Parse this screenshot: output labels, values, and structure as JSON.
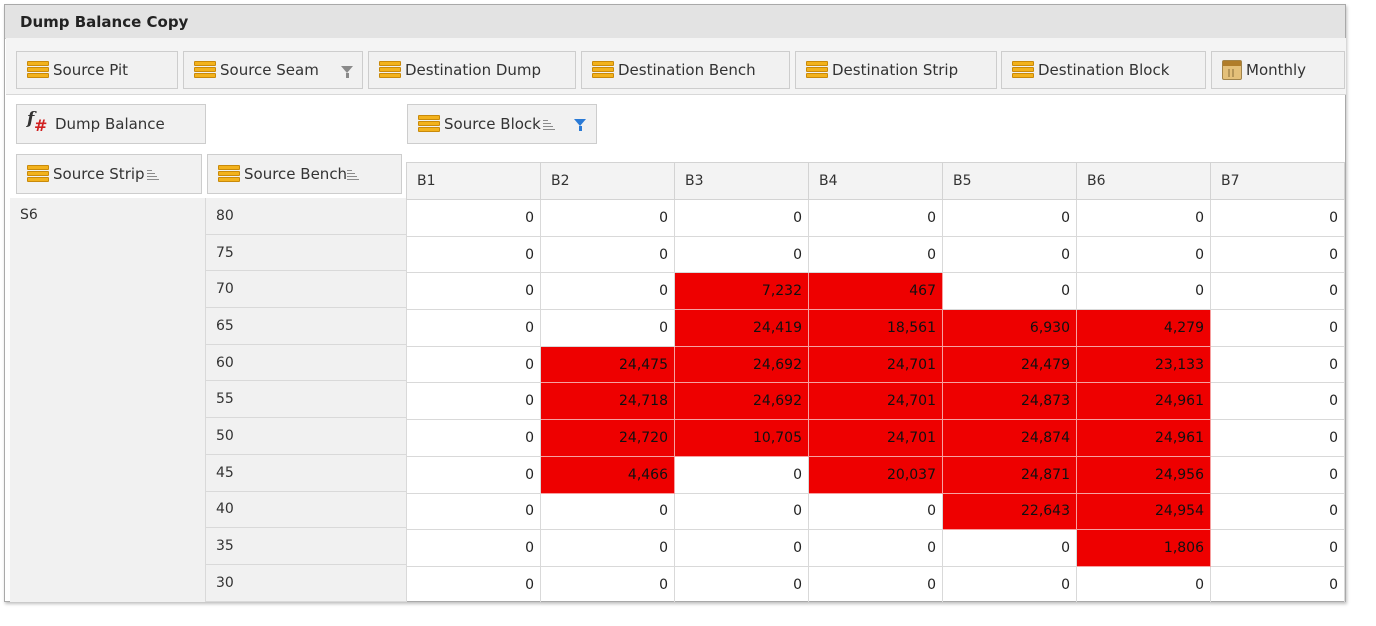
{
  "title": "Dump Balance Copy",
  "filter_fields": [
    {
      "label": "Source Pit",
      "icon": "field-icon"
    },
    {
      "label": "Source Seam",
      "icon": "field-icon",
      "filter_icon": "filter-icon"
    },
    {
      "label": "Destination Dump",
      "icon": "field-icon"
    },
    {
      "label": "Destination Bench",
      "icon": "field-icon"
    },
    {
      "label": "Destination Strip",
      "icon": "field-icon"
    },
    {
      "label": "Destination Block",
      "icon": "field-icon"
    },
    {
      "label": "Monthly",
      "icon": "calendar-icon"
    }
  ],
  "data_field": {
    "label": "Dump Balance",
    "icon": "calculated-field-icon"
  },
  "column_field": {
    "label": "Source Block",
    "icon": "field-icon",
    "sort_icon": "sort-icon",
    "filter_icon": "filter-active-icon"
  },
  "row_fields": [
    {
      "label": "Source Strip",
      "icon": "field-icon",
      "sort_icon": "sort-icon"
    },
    {
      "label": "Source Bench",
      "icon": "field-icon",
      "sort_icon": "sort-icon"
    }
  ],
  "columns": [
    "B1",
    "B2",
    "B3",
    "B4",
    "B5",
    "B6",
    "B7"
  ],
  "outer_row": "S6",
  "highlight_color": "#ee0000",
  "rows": [
    {
      "bench": "80",
      "cells": [
        {
          "v": "0",
          "h": false
        },
        {
          "v": "0",
          "h": false
        },
        {
          "v": "0",
          "h": false
        },
        {
          "v": "0",
          "h": false
        },
        {
          "v": "0",
          "h": false
        },
        {
          "v": "0",
          "h": false
        },
        {
          "v": "0",
          "h": false
        }
      ]
    },
    {
      "bench": "75",
      "cells": [
        {
          "v": "0",
          "h": false
        },
        {
          "v": "0",
          "h": false
        },
        {
          "v": "0",
          "h": false
        },
        {
          "v": "0",
          "h": false
        },
        {
          "v": "0",
          "h": false
        },
        {
          "v": "0",
          "h": false
        },
        {
          "v": "0",
          "h": false
        }
      ]
    },
    {
      "bench": "70",
      "cells": [
        {
          "v": "0",
          "h": false
        },
        {
          "v": "0",
          "h": false
        },
        {
          "v": "7,232",
          "h": true
        },
        {
          "v": "467",
          "h": true
        },
        {
          "v": "0",
          "h": false
        },
        {
          "v": "0",
          "h": false
        },
        {
          "v": "0",
          "h": false
        }
      ]
    },
    {
      "bench": "65",
      "cells": [
        {
          "v": "0",
          "h": false
        },
        {
          "v": "0",
          "h": false
        },
        {
          "v": "24,419",
          "h": true
        },
        {
          "v": "18,561",
          "h": true
        },
        {
          "v": "6,930",
          "h": true
        },
        {
          "v": "4,279",
          "h": true
        },
        {
          "v": "0",
          "h": false
        }
      ]
    },
    {
      "bench": "60",
      "cells": [
        {
          "v": "0",
          "h": false
        },
        {
          "v": "24,475",
          "h": true
        },
        {
          "v": "24,692",
          "h": true
        },
        {
          "v": "24,701",
          "h": true
        },
        {
          "v": "24,479",
          "h": true
        },
        {
          "v": "23,133",
          "h": true
        },
        {
          "v": "0",
          "h": false
        }
      ]
    },
    {
      "bench": "55",
      "cells": [
        {
          "v": "0",
          "h": false
        },
        {
          "v": "24,718",
          "h": true
        },
        {
          "v": "24,692",
          "h": true
        },
        {
          "v": "24,701",
          "h": true
        },
        {
          "v": "24,873",
          "h": true
        },
        {
          "v": "24,961",
          "h": true
        },
        {
          "v": "0",
          "h": false
        }
      ]
    },
    {
      "bench": "50",
      "cells": [
        {
          "v": "0",
          "h": false
        },
        {
          "v": "24,720",
          "h": true
        },
        {
          "v": "10,705",
          "h": true
        },
        {
          "v": "24,701",
          "h": true
        },
        {
          "v": "24,874",
          "h": true
        },
        {
          "v": "24,961",
          "h": true
        },
        {
          "v": "0",
          "h": false
        }
      ]
    },
    {
      "bench": "45",
      "cells": [
        {
          "v": "0",
          "h": false
        },
        {
          "v": "4,466",
          "h": true
        },
        {
          "v": "0",
          "h": false
        },
        {
          "v": "20,037",
          "h": true
        },
        {
          "v": "24,871",
          "h": true
        },
        {
          "v": "24,956",
          "h": true
        },
        {
          "v": "0",
          "h": false
        }
      ]
    },
    {
      "bench": "40",
      "cells": [
        {
          "v": "0",
          "h": false
        },
        {
          "v": "0",
          "h": false
        },
        {
          "v": "0",
          "h": false
        },
        {
          "v": "0",
          "h": false
        },
        {
          "v": "22,643",
          "h": true
        },
        {
          "v": "24,954",
          "h": true
        },
        {
          "v": "0",
          "h": false
        }
      ]
    },
    {
      "bench": "35",
      "cells": [
        {
          "v": "0",
          "h": false
        },
        {
          "v": "0",
          "h": false
        },
        {
          "v": "0",
          "h": false
        },
        {
          "v": "0",
          "h": false
        },
        {
          "v": "0",
          "h": false
        },
        {
          "v": "1,806",
          "h": true
        },
        {
          "v": "0",
          "h": false
        }
      ]
    },
    {
      "bench": "30",
      "cells": [
        {
          "v": "0",
          "h": false
        },
        {
          "v": "0",
          "h": false
        },
        {
          "v": "0",
          "h": false
        },
        {
          "v": "0",
          "h": false
        },
        {
          "v": "0",
          "h": false
        },
        {
          "v": "0",
          "h": false
        },
        {
          "v": "0",
          "h": false
        }
      ]
    }
  ]
}
